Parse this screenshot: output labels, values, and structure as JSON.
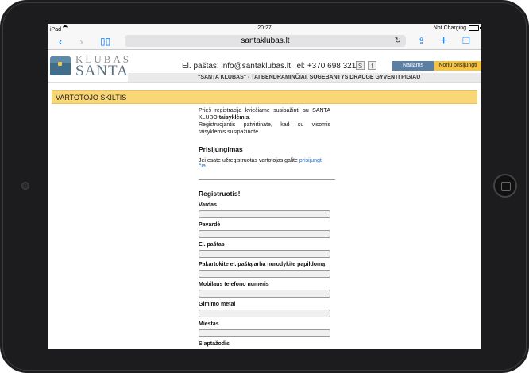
{
  "status": {
    "device": "iPad",
    "time": "20:27",
    "battery": "Not Charging"
  },
  "browser": {
    "url": "santaklubas.lt"
  },
  "header": {
    "logo_top": "KLUBAS",
    "logo_bottom": "SANTA",
    "contact": "El. paštas: info@santaklubas.lt Tel: +370 698 32131",
    "social_s": "S",
    "social_f": "f",
    "members_label": "Nariams",
    "login_label": "Noriu prisijungti",
    "slogan": "\"SANTA KLUBAS\" - TAI BENDRAMINČIAI, SUGEBANTYS DRAUGE GYVENTI PIGIAU"
  },
  "section_title": "VARTOTOJO SKILTIS",
  "intro": {
    "p1_start": "Prieš registraciją kviečiame susipažinti su SANTA KLUBO ",
    "p1_bold": "taisyklėmis",
    "p1_end": ".",
    "p2": "Registruojantis patvirtinate, kad su visomis taisyklėmis susipažinote"
  },
  "login": {
    "title": "Prisijungimas",
    "text": "Jei esate užregistruotas vartotojas galite ",
    "link": "prisijungti čia",
    "text_end": "."
  },
  "register": {
    "title": "Registruotis!",
    "fields": [
      "Vardas",
      "Pavardė",
      "El. paštas",
      "Pakartokite el. paštą arba nurodykite papildomą",
      "Mobilaus telefono numeris",
      "Gimimo metai",
      "Miestas",
      "Slaptažodis"
    ]
  }
}
